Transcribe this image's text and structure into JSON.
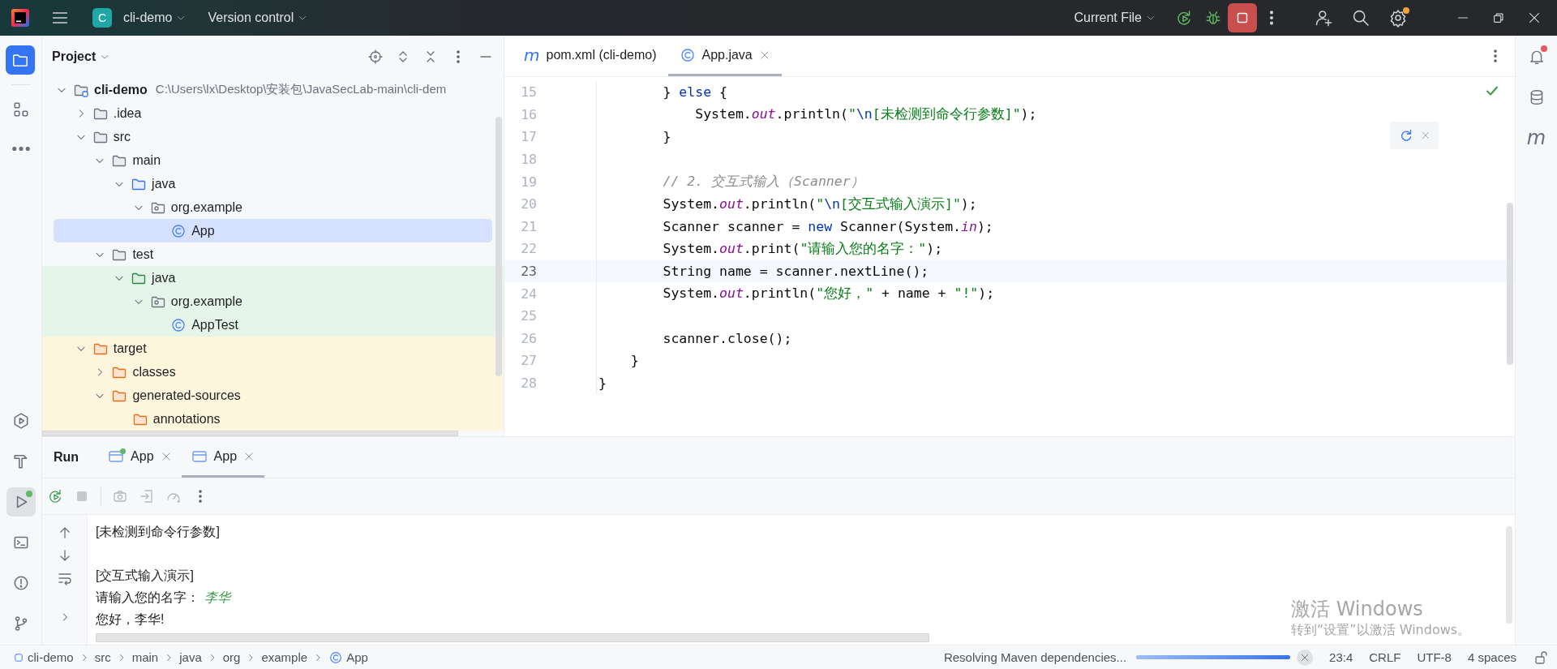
{
  "title_bar": {
    "project_badge": "C",
    "project": "cli-demo",
    "vcs": "Version control",
    "run_config": "Current File",
    "settings_badge": true
  },
  "left_toolbar": {
    "top": [
      {
        "kind": "project",
        "selected": true,
        "running": false
      },
      {
        "kind": "structure",
        "selected": false,
        "running": false
      },
      {
        "kind": "more",
        "selected": false,
        "running": false
      }
    ],
    "bottom": [
      {
        "kind": "services",
        "selected": false,
        "running": false
      },
      {
        "kind": "build",
        "selected": false,
        "running": false
      },
      {
        "kind": "run",
        "selected": true,
        "running": true
      },
      {
        "kind": "terminal",
        "selected": false,
        "running": false
      },
      {
        "kind": "problems",
        "selected": false,
        "running": false
      },
      {
        "kind": "git",
        "selected": false,
        "running": false
      }
    ]
  },
  "project_panel": {
    "title": "Project",
    "tree": [
      {
        "label": "cli-demo",
        "kind": "module",
        "detail": "C:\\Users\\lx\\Desktop\\安装包\\JavaSecLab-main\\cli-dem",
        "expanded": true,
        "selected": false,
        "children": [
          {
            "label": ".idea",
            "kind": "folder",
            "expanded": false,
            "selected": false
          },
          {
            "label": "src",
            "kind": "folder",
            "expanded": true,
            "selected": false,
            "children": [
              {
                "label": "main",
                "kind": "folder",
                "expanded": true,
                "selected": false,
                "children": [
                  {
                    "label": "java",
                    "kind": "source-folder",
                    "expanded": true,
                    "selected": false,
                    "children": [
                      {
                        "label": "org.example",
                        "kind": "package",
                        "expanded": true,
                        "selected": false,
                        "children": [
                          {
                            "label": "App",
                            "kind": "class",
                            "selected": true
                          }
                        ]
                      }
                    ]
                  }
                ]
              },
              {
                "label": "test",
                "kind": "folder",
                "expanded": true,
                "selected": false,
                "children": [
                  {
                    "label": "java",
                    "kind": "test-folder",
                    "expanded": true,
                    "selected": false,
                    "children": [
                      {
                        "label": "org.example",
                        "kind": "package",
                        "expanded": true,
                        "selected": false,
                        "children": [
                          {
                            "label": "AppTest",
                            "kind": "class",
                            "selected": false
                          }
                        ]
                      }
                    ]
                  }
                ]
              }
            ]
          },
          {
            "label": "target",
            "kind": "excluded-folder",
            "expanded": true,
            "selected": false,
            "children": [
              {
                "label": "classes",
                "kind": "excluded-folder",
                "expanded": false,
                "selected": false
              },
              {
                "label": "generated-sources",
                "kind": "excluded-folder",
                "expanded": true,
                "selected": false,
                "children": [
                  {
                    "label": "annotations",
                    "kind": "excluded-folder",
                    "selected": false
                  }
                ]
              }
            ]
          }
        ]
      }
    ]
  },
  "editor": {
    "tabs": [
      {
        "kind": "maven",
        "glyph": "m",
        "label": "pom.xml (cli-demo)",
        "selected": false,
        "closable": false
      },
      {
        "kind": "class",
        "label": "App.java",
        "selected": true,
        "closable": true
      }
    ],
    "lines": [
      {
        "number": "15",
        "current": false,
        "tokens": [
          {
            "kind": "plain",
            "text": "        } "
          },
          {
            "kind": "keyword",
            "text": "else"
          },
          {
            "kind": "plain",
            "text": " {"
          }
        ]
      },
      {
        "number": "16",
        "current": false,
        "tokens": [
          {
            "kind": "plain",
            "text": "            System."
          },
          {
            "kind": "field",
            "text": "out"
          },
          {
            "kind": "plain",
            "text": ".println("
          },
          {
            "kind": "string",
            "text": "\""
          },
          {
            "kind": "escape",
            "text": "\\n"
          },
          {
            "kind": "string",
            "text": "[未检测到命令行参数]\""
          },
          {
            "kind": "plain",
            "text": ");"
          }
        ]
      },
      {
        "number": "17",
        "current": false,
        "tokens": [
          {
            "kind": "plain",
            "text": "        }"
          }
        ]
      },
      {
        "number": "18",
        "current": false
      },
      {
        "number": "19",
        "current": false,
        "tokens": [
          {
            "kind": "comment",
            "text": "        // 2. 交互式输入（Scanner）"
          }
        ]
      },
      {
        "number": "20",
        "current": false,
        "tokens": [
          {
            "kind": "plain",
            "text": "        System."
          },
          {
            "kind": "field",
            "text": "out"
          },
          {
            "kind": "plain",
            "text": ".println("
          },
          {
            "kind": "string",
            "text": "\""
          },
          {
            "kind": "escape",
            "text": "\\n"
          },
          {
            "kind": "string",
            "text": "[交互式输入演示]\""
          },
          {
            "kind": "plain",
            "text": ");"
          }
        ]
      },
      {
        "number": "21",
        "current": false,
        "tokens": [
          {
            "kind": "plain",
            "text": "        Scanner scanner = "
          },
          {
            "kind": "keyword",
            "text": "new"
          },
          {
            "kind": "plain",
            "text": " Scanner(System."
          },
          {
            "kind": "field",
            "text": "in"
          },
          {
            "kind": "plain",
            "text": ");"
          }
        ]
      },
      {
        "number": "22",
        "current": false,
        "tokens": [
          {
            "kind": "plain",
            "text": "        System."
          },
          {
            "kind": "field",
            "text": "out"
          },
          {
            "kind": "plain",
            "text": ".print("
          },
          {
            "kind": "string",
            "text": "\"请输入您的名字：\""
          },
          {
            "kind": "plain",
            "text": ");"
          }
        ]
      },
      {
        "number": "23",
        "current": true,
        "tokens": [
          {
            "kind": "plain",
            "text": "        String name = scanner.nextLine();"
          }
        ]
      },
      {
        "number": "24",
        "current": false,
        "tokens": [
          {
            "kind": "plain",
            "text": "        System."
          },
          {
            "kind": "field",
            "text": "out"
          },
          {
            "kind": "plain",
            "text": ".println("
          },
          {
            "kind": "string",
            "text": "\"您好，\""
          },
          {
            "kind": "plain",
            "text": " + name + "
          },
          {
            "kind": "string",
            "text": "\"!\""
          },
          {
            "kind": "plain",
            "text": ");"
          }
        ]
      },
      {
        "number": "25",
        "current": false
      },
      {
        "number": "26",
        "current": false,
        "tokens": [
          {
            "kind": "plain",
            "text": "        scanner.close();"
          }
        ]
      },
      {
        "number": "27",
        "current": false,
        "tokens": [
          {
            "kind": "plain",
            "text": "    }"
          }
        ]
      },
      {
        "number": "28",
        "current": false,
        "tokens": [
          {
            "kind": "plain",
            "text": "}"
          }
        ]
      }
    ]
  },
  "right_toolbar": [
    {
      "kind": "notifications",
      "unread": true
    },
    {
      "kind": "database",
      "unread": false
    },
    {
      "kind": "maven",
      "glyph": "m",
      "unread": false
    }
  ],
  "run_panel": {
    "title": "Run",
    "tabs": [
      {
        "label": "App",
        "running": true,
        "selected": false
      },
      {
        "label": "App",
        "running": false,
        "selected": true
      }
    ],
    "console_blocks": [
      {
        "lines": [
          {
            "segments": [
              {
                "kind": "output",
                "text": "[未检测到命令行参数]"
              }
            ]
          }
        ]
      },
      {
        "lines": [
          {
            "segments": [
              {
                "kind": "output",
                "text": "[交互式输入演示]"
              }
            ]
          },
          {
            "segments": [
              {
                "kind": "output",
                "text": "请输入您的名字："
              },
              {
                "kind": "input",
                "text": "李华"
              }
            ]
          },
          {
            "segments": [
              {
                "kind": "output",
                "text": "您好，李华!"
              }
            ]
          }
        ]
      }
    ]
  },
  "status_bar": {
    "breadcrumbs": [
      {
        "kind": "module",
        "label": "cli-demo"
      },
      {
        "kind": "folder",
        "label": "src"
      },
      {
        "kind": "folder",
        "label": "main"
      },
      {
        "kind": "folder",
        "label": "java"
      },
      {
        "kind": "folder",
        "label": "org"
      },
      {
        "kind": "folder",
        "label": "example"
      },
      {
        "kind": "class",
        "label": "App"
      }
    ],
    "task": "Resolving Maven dependencies...",
    "progress": {
      "level": 1
    },
    "position": "23:4",
    "line_separator": "CRLF",
    "encoding": "UTF-8",
    "indent": "4 spaces"
  },
  "activation_notice": {
    "title": "激活 Windows",
    "message": "转到“设置”以激活 Windows。"
  }
}
